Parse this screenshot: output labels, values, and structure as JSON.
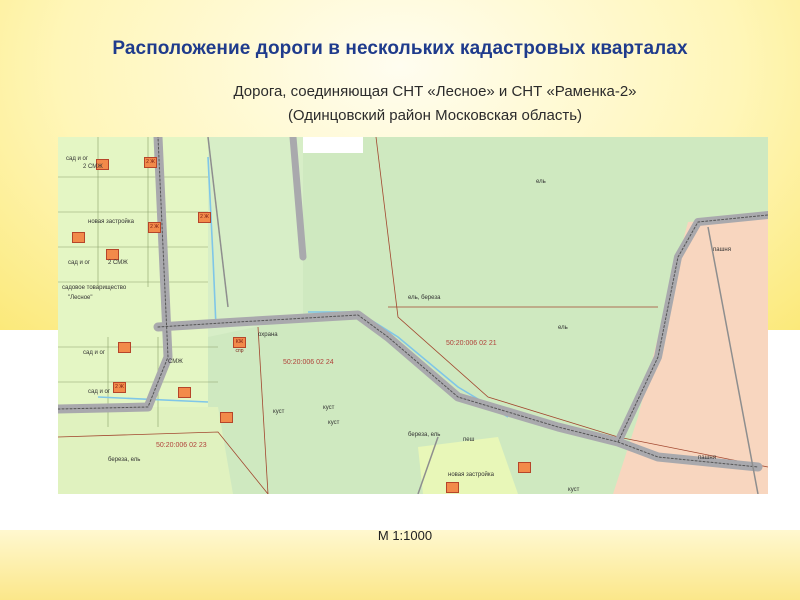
{
  "title": "Расположение дороги в нескольких кадастровых кварталах",
  "subtitle_line1": "Дорога, соединяющая СНТ «Лесное» и СНТ «Раменка-2»",
  "subtitle_line2": "(Одинцовский район Московская область)",
  "scale": "М 1:1000",
  "map": {
    "cadastral_quarters": [
      "50:20:006 02 24",
      "50:20:006 02 21",
      "50:20:006 02 23"
    ],
    "labels": {
      "snt_lesnoe": "\"Лесное\"",
      "tovarishestvo": "садовое товарищество",
      "sad_i_og": "сад и ог",
      "el": "ель",
      "el_bereza": "ель, береза",
      "bereza_el": "береза, ель",
      "pashnya": "пашня",
      "kust": "куст",
      "ohrana": "охрана",
      "gsk": "2 СМЖ",
      "new_build": "новая застройка",
      "pesh": "пеш",
      "n2zh": "2 Ж",
      "kzh_spr": "КЖ спр",
      "smzh": "СМЖ"
    },
    "colors": {
      "forest": "#cfe9c0",
      "garden": "#e4f6c4",
      "field": "#f8d6bf",
      "road": "#a9a9ad",
      "building": "#f28a4a",
      "water": "#7fc6e8",
      "cadastral_line": "#a2472f"
    }
  }
}
